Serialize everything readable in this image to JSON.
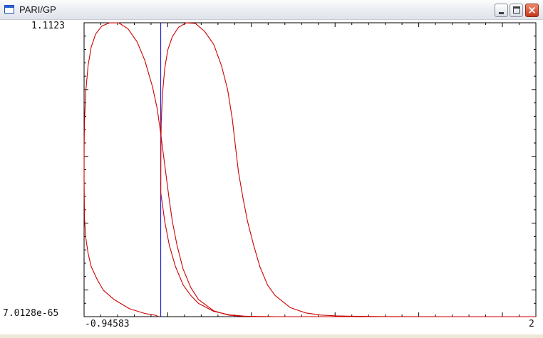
{
  "window": {
    "title": "PARI/GP",
    "icon": "pari-window-icon",
    "controls": [
      "minimize-icon",
      "maximize-icon",
      "close-icon"
    ]
  },
  "chart_data": {
    "type": "line",
    "title": "",
    "xlabel": "",
    "ylabel": "",
    "xlim": [
      -0.94583,
      2
    ],
    "ylim": [
      7.0128e-65,
      1.1123
    ],
    "tick_labels": {
      "x_min": "-0.94583",
      "x_max": "2",
      "y_min": "7.0128e-65",
      "y_max": "1.1123"
    },
    "series": [
      {
        "color": "#cc0000",
        "points": [
          [
            -0.9458,
            0.52
          ],
          [
            -0.9455,
            0.65
          ],
          [
            -0.943,
            0.74
          ],
          [
            -0.935,
            0.85
          ],
          [
            -0.92,
            0.95
          ],
          [
            -0.9,
            1.02
          ],
          [
            -0.87,
            1.07
          ],
          [
            -0.83,
            1.1
          ],
          [
            -0.78,
            1.112
          ],
          [
            -0.72,
            1.112
          ],
          [
            -0.66,
            1.09
          ],
          [
            -0.6,
            1.04
          ],
          [
            -0.55,
            0.97
          ],
          [
            -0.5,
            0.87
          ],
          [
            -0.47,
            0.79
          ],
          [
            -0.45,
            0.71
          ],
          [
            -0.43,
            0.62
          ],
          [
            -0.41,
            0.53
          ],
          [
            -0.39,
            0.44
          ],
          [
            -0.37,
            0.36
          ],
          [
            -0.34,
            0.27
          ],
          [
            -0.3,
            0.18
          ],
          [
            -0.25,
            0.11
          ],
          [
            -0.2,
            0.065
          ],
          [
            -0.1,
            0.022
          ],
          [
            0,
            0.005
          ],
          [
            0.1,
            0.001
          ],
          [
            0.3,
            0.0001
          ],
          [
            0.6,
            0
          ],
          [
            1.0,
            0
          ],
          [
            1.5,
            0
          ],
          [
            2,
            0
          ]
        ]
      },
      {
        "color": "#cc0000",
        "points": [
          [
            -0.9458,
            0.52
          ],
          [
            -0.943,
            0.37
          ],
          [
            -0.935,
            0.3
          ],
          [
            -0.92,
            0.24
          ],
          [
            -0.9,
            0.19
          ],
          [
            -0.86,
            0.14
          ],
          [
            -0.82,
            0.1
          ],
          [
            -0.75,
            0.065
          ],
          [
            -0.65,
            0.03
          ],
          [
            -0.55,
            0.012
          ],
          [
            -0.48,
            0.005
          ],
          [
            -0.46,
            0
          ]
        ]
      },
      {
        "color": "#cc0000",
        "points": [
          [
            -0.4458,
            0.47
          ],
          [
            -0.42,
            0.36
          ],
          [
            -0.39,
            0.27
          ],
          [
            -0.35,
            0.19
          ],
          [
            -0.3,
            0.12
          ],
          [
            -0.25,
            0.08
          ],
          [
            -0.2,
            0.05
          ],
          [
            -0.1,
            0.02
          ],
          [
            0,
            0.007
          ],
          [
            0.1,
            0.002
          ],
          [
            0.15,
            0.0007
          ],
          [
            0.2,
            0
          ]
        ]
      },
      {
        "color": "#cc0000",
        "points": [
          [
            -0.4458,
            0.47
          ],
          [
            -0.4455,
            0.6
          ],
          [
            -0.443,
            0.73
          ],
          [
            -0.435,
            0.84
          ],
          [
            -0.42,
            0.94
          ],
          [
            -0.4,
            1.01
          ],
          [
            -0.37,
            1.06
          ],
          [
            -0.33,
            1.095
          ],
          [
            -0.28,
            1.112
          ],
          [
            -0.22,
            1.11
          ],
          [
            -0.16,
            1.08
          ],
          [
            -0.1,
            1.03
          ],
          [
            -0.05,
            0.95
          ],
          [
            -0.01,
            0.86
          ],
          [
            0.02,
            0.75
          ],
          [
            0.04,
            0.65
          ],
          [
            0.06,
            0.55
          ],
          [
            0.09,
            0.45
          ],
          [
            0.12,
            0.36
          ],
          [
            0.16,
            0.27
          ],
          [
            0.2,
            0.19
          ],
          [
            0.25,
            0.12
          ],
          [
            0.3,
            0.08
          ],
          [
            0.4,
            0.034
          ],
          [
            0.5,
            0.014
          ],
          [
            0.6,
            0.006
          ],
          [
            0.7,
            0.003
          ],
          [
            0.8,
            0.0015
          ],
          [
            1.0,
            0.0004
          ],
          [
            1.5,
            0
          ],
          [
            2,
            0
          ]
        ]
      }
    ],
    "vertical_line": {
      "x": -0.4458,
      "color": "#0000cc"
    },
    "x_minor_ticks": 27,
    "y_minor_ticks": 22
  }
}
